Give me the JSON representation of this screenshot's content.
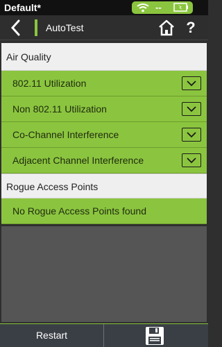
{
  "status_bar": {
    "profile_name": "Default*",
    "wifi_icon": "wifi-icon",
    "signal_text": "--",
    "battery_icon": "battery-charging-icon",
    "accent_color": "#8bc53f"
  },
  "header": {
    "back_icon": "back-chevron-icon",
    "title": "AutoTest",
    "home_icon": "home-icon",
    "help_label": "?"
  },
  "sections": {
    "air_quality": {
      "title": "Air Quality",
      "items": [
        {
          "label": "802.11 Utilization",
          "icon": "chevron-down-icon"
        },
        {
          "label": "Non 802.11 Utilization",
          "icon": "chevron-down-icon"
        },
        {
          "label": "Co-Channel Interference",
          "icon": "chevron-down-icon"
        },
        {
          "label": "Adjacent Channel Interference",
          "icon": "chevron-down-icon"
        }
      ]
    },
    "rogue": {
      "title": "Rogue Access Points",
      "message": "No Rogue Access Points found"
    }
  },
  "bottom_bar": {
    "restart_label": "Restart",
    "save_icon": "save-floppy-icon"
  }
}
